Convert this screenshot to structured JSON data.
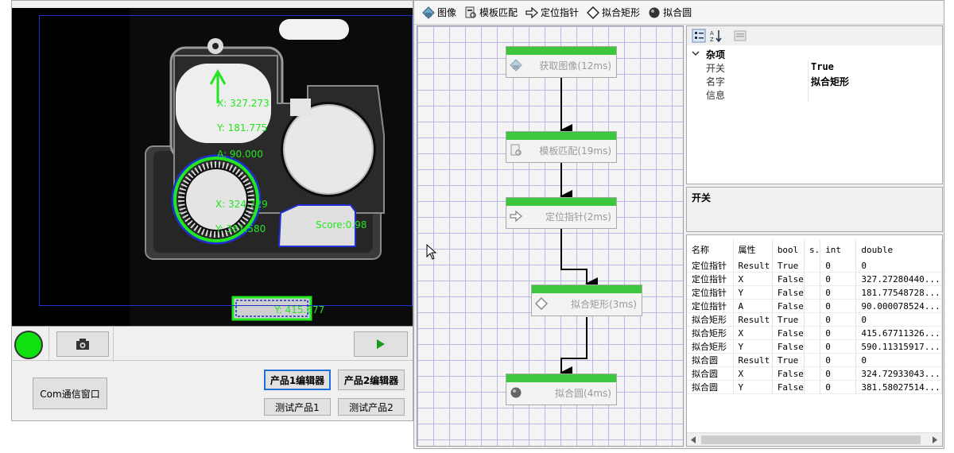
{
  "camera": {
    "overlay": [
      {
        "text": "X: 327.273"
      },
      {
        "text": "Y: 181.775"
      },
      {
        "text": "A: 90.000"
      },
      {
        "text": "X: 324.729"
      },
      {
        "text": "Y: 381.580"
      },
      {
        "text": "Score:0.98"
      },
      {
        "text": "Y: 415.677"
      }
    ],
    "overlay_color": "#22e622",
    "roi_color": "#1f2fd0"
  },
  "left_toolbar": {
    "status_color": "#10e010",
    "capture_icon": "camera-icon",
    "run_icon": "play-icon"
  },
  "left_buttons": {
    "com": "Com通信窗口",
    "edit1": "产品1编辑器",
    "edit2": "产品2编辑器",
    "test1": "测试产品1",
    "test2": "测试产品2"
  },
  "toolbox": {
    "items": [
      {
        "label": "图像",
        "icon": "image-icon"
      },
      {
        "label": "模板匹配",
        "icon": "template-match-icon"
      },
      {
        "label": "定位指针",
        "icon": "locate-pointer-icon"
      },
      {
        "label": "拟合矩形",
        "icon": "fit-rect-icon"
      },
      {
        "label": "拟合圆",
        "icon": "fit-circle-icon"
      }
    ]
  },
  "flow": {
    "nodes": [
      {
        "label": "获取图像(12ms)",
        "icon": "image-icon"
      },
      {
        "label": "模板匹配(19ms)",
        "icon": "template-match-icon"
      },
      {
        "label": "定位指针(2ms)",
        "icon": "locate-pointer-icon"
      },
      {
        "label": "拟合矩形(3ms)",
        "icon": "fit-rect-icon"
      },
      {
        "label": "拟合圆(4ms)",
        "icon": "fit-circle-icon"
      }
    ],
    "node_bar_color": "#3cc83c"
  },
  "properties": {
    "category": "杂项",
    "rows": [
      {
        "key": "开关",
        "value": "True"
      },
      {
        "key": "名字",
        "value": "拟合矩形"
      },
      {
        "key": "信息",
        "value": ""
      }
    ]
  },
  "description": {
    "title": "开关"
  },
  "results": {
    "columns": [
      "名称",
      "属性",
      "bool",
      "s.",
      "int",
      "double"
    ],
    "rows": [
      [
        "定位指针",
        "Result",
        "True",
        "",
        "0",
        "0"
      ],
      [
        "定位指针",
        "X",
        "False",
        "",
        "0",
        "327.27280440..."
      ],
      [
        "定位指针",
        "Y",
        "False",
        "",
        "0",
        "181.77548728..."
      ],
      [
        "定位指针",
        "A",
        "False",
        "",
        "0",
        "90.000078524..."
      ],
      [
        "拟合矩形",
        "Result",
        "True",
        "",
        "0",
        "0"
      ],
      [
        "拟合矩形",
        "X",
        "False",
        "",
        "0",
        "415.67711326..."
      ],
      [
        "拟合矩形",
        "Y",
        "False",
        "",
        "0",
        "590.11315917..."
      ],
      [
        "拟合圆",
        "Result",
        "True",
        "",
        "0",
        "0"
      ],
      [
        "拟合圆",
        "X",
        "False",
        "",
        "0",
        "324.72933043..."
      ],
      [
        "拟合圆",
        "Y",
        "False",
        "",
        "0",
        "381.58027514..."
      ]
    ]
  }
}
